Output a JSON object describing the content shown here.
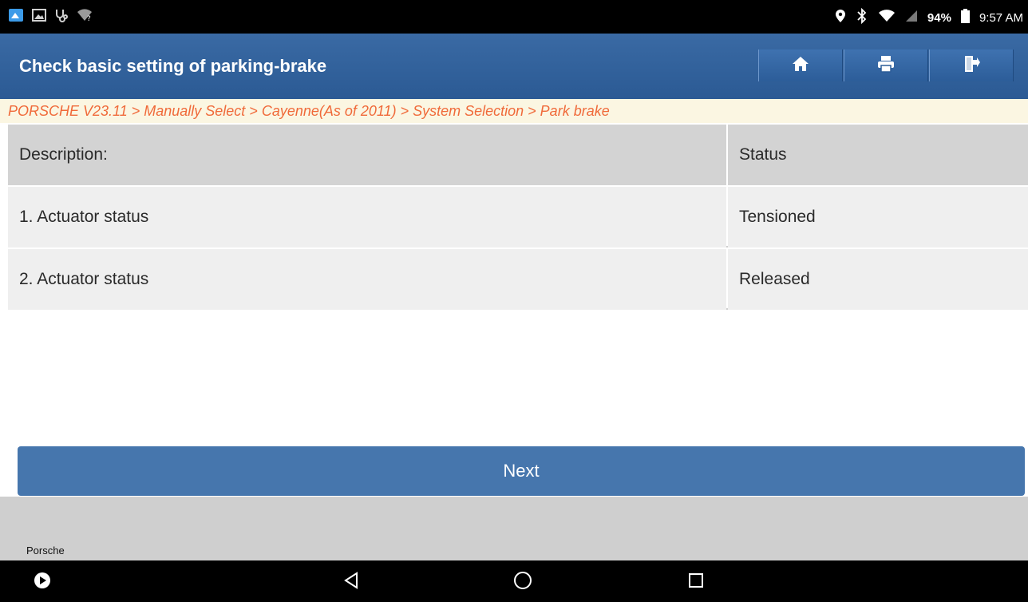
{
  "status_bar": {
    "battery": "94%",
    "time": "9:57 AM"
  },
  "header": {
    "title": "Check basic setting of parking-brake",
    "buttons": [
      "home-icon",
      "print-icon",
      "exit-icon"
    ]
  },
  "breadcrumb": "PORSCHE V23.11 > Manually Select > Cayenne(As of 2011) > System Selection > Park brake",
  "table": {
    "headers": {
      "description": "Description:",
      "status": "Status"
    },
    "rows": [
      {
        "description": "1. Actuator status",
        "status": "Tensioned"
      },
      {
        "description": "2. Actuator status",
        "status": "Released"
      }
    ]
  },
  "actions": {
    "next_label": "Next"
  },
  "footer": {
    "brand": "Porsche"
  },
  "colors": {
    "header": "#2b5a94",
    "button": "#4676ad",
    "breadcrumb_text": "#f06a3a"
  }
}
